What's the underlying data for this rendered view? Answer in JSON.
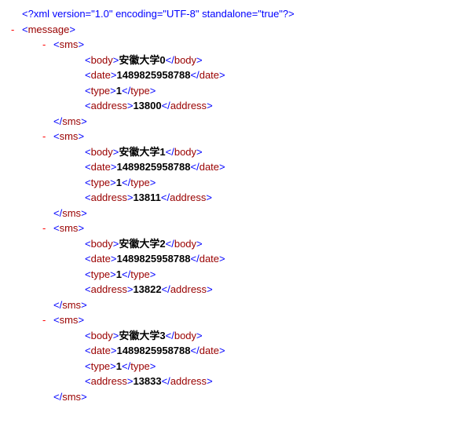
{
  "xml_decl": "<?xml version=\"1.0\" encoding=\"UTF-8\" standalone=\"true\"?>",
  "toggle": "-",
  "root_open": "<message>",
  "sms_open": "<sms>",
  "sms_close": "</sms>",
  "body_open": "<body>",
  "body_close": "</body>",
  "date_open": "<date>",
  "date_close": "</date>",
  "type_open": "<type>",
  "type_close": "</type>",
  "address_open": "<address>",
  "address_close": "</address>",
  "records": [
    {
      "body": "安徽大学0",
      "date": "1489825958788",
      "type": "1",
      "address": "13800"
    },
    {
      "body": "安徽大学1",
      "date": "1489825958788",
      "type": "1",
      "address": "13811"
    },
    {
      "body": "安徽大学2",
      "date": "1489825958788",
      "type": "1",
      "address": "13822"
    },
    {
      "body": "安徽大学3",
      "date": "1489825958788",
      "type": "1",
      "address": "13833"
    }
  ]
}
